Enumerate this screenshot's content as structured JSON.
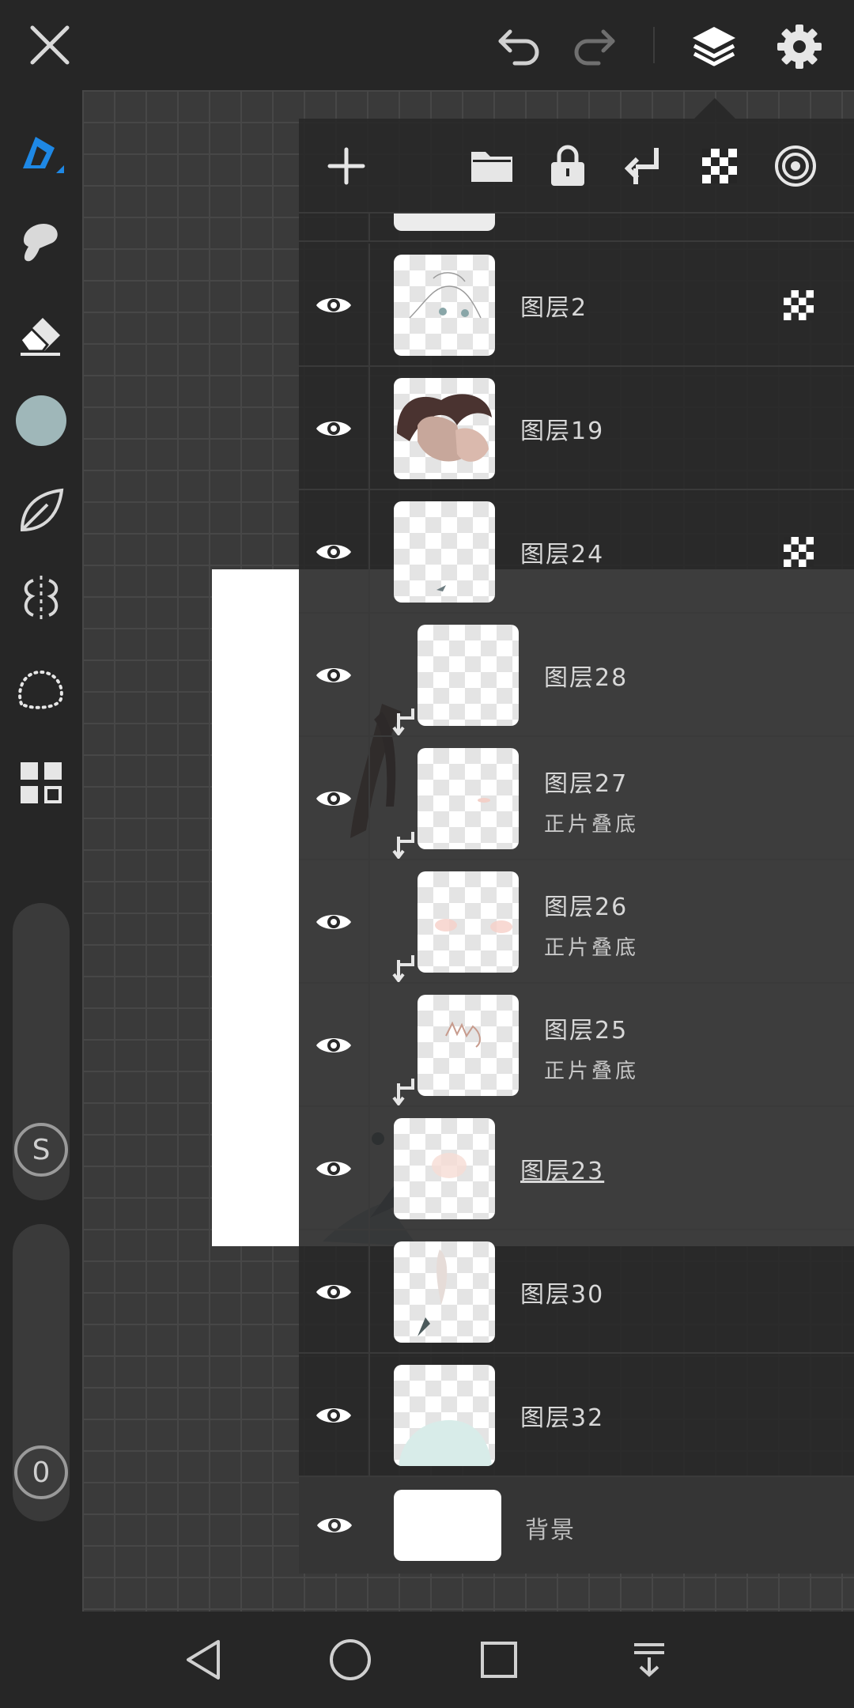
{
  "layers": [
    {
      "name": "图层2",
      "mode": "",
      "alpha_locked": true,
      "clipped": false
    },
    {
      "name": "图层19",
      "mode": "",
      "alpha_locked": false,
      "clipped": false
    },
    {
      "name": "图层24",
      "mode": "",
      "alpha_locked": true,
      "clipped": false
    },
    {
      "name": "图层28",
      "mode": "",
      "alpha_locked": false,
      "clipped": true
    },
    {
      "name": "图层27",
      "mode": "正片叠底",
      "alpha_locked": false,
      "clipped": true
    },
    {
      "name": "图层26",
      "mode": "正片叠底",
      "alpha_locked": false,
      "clipped": true
    },
    {
      "name": "图层25",
      "mode": "正片叠底",
      "alpha_locked": false,
      "clipped": true
    },
    {
      "name": "图层23",
      "mode": "",
      "alpha_locked": false,
      "clipped": false
    },
    {
      "name": "图层30",
      "mode": "",
      "alpha_locked": false,
      "clipped": false
    },
    {
      "name": "图层32",
      "mode": "",
      "alpha_locked": false,
      "clipped": false
    }
  ],
  "background_layer": {
    "name": "背景"
  },
  "size_slider": {
    "label": "S"
  },
  "opacity_slider": {
    "label": "0"
  },
  "colors": {
    "current_color": "#9fb7b9",
    "accent": "#1e88e5",
    "panel_bg": "#282828"
  },
  "icons": {
    "top_bar": [
      "close-icon",
      "undo-icon",
      "redo-icon",
      "layers-icon",
      "settings-icon"
    ],
    "tools": [
      "brush-icon",
      "smudge-icon",
      "eraser-icon",
      "color-swatch",
      "fill-icon",
      "symmetry-icon",
      "lasso-icon",
      "gallery-icon"
    ],
    "panel": [
      "add-layer-icon",
      "folder-icon",
      "lock-icon",
      "clip-icon",
      "alpha-lock-icon",
      "blend-icon"
    ],
    "nav": [
      "back-icon",
      "home-icon",
      "recents-icon",
      "hide-nav-icon"
    ]
  }
}
